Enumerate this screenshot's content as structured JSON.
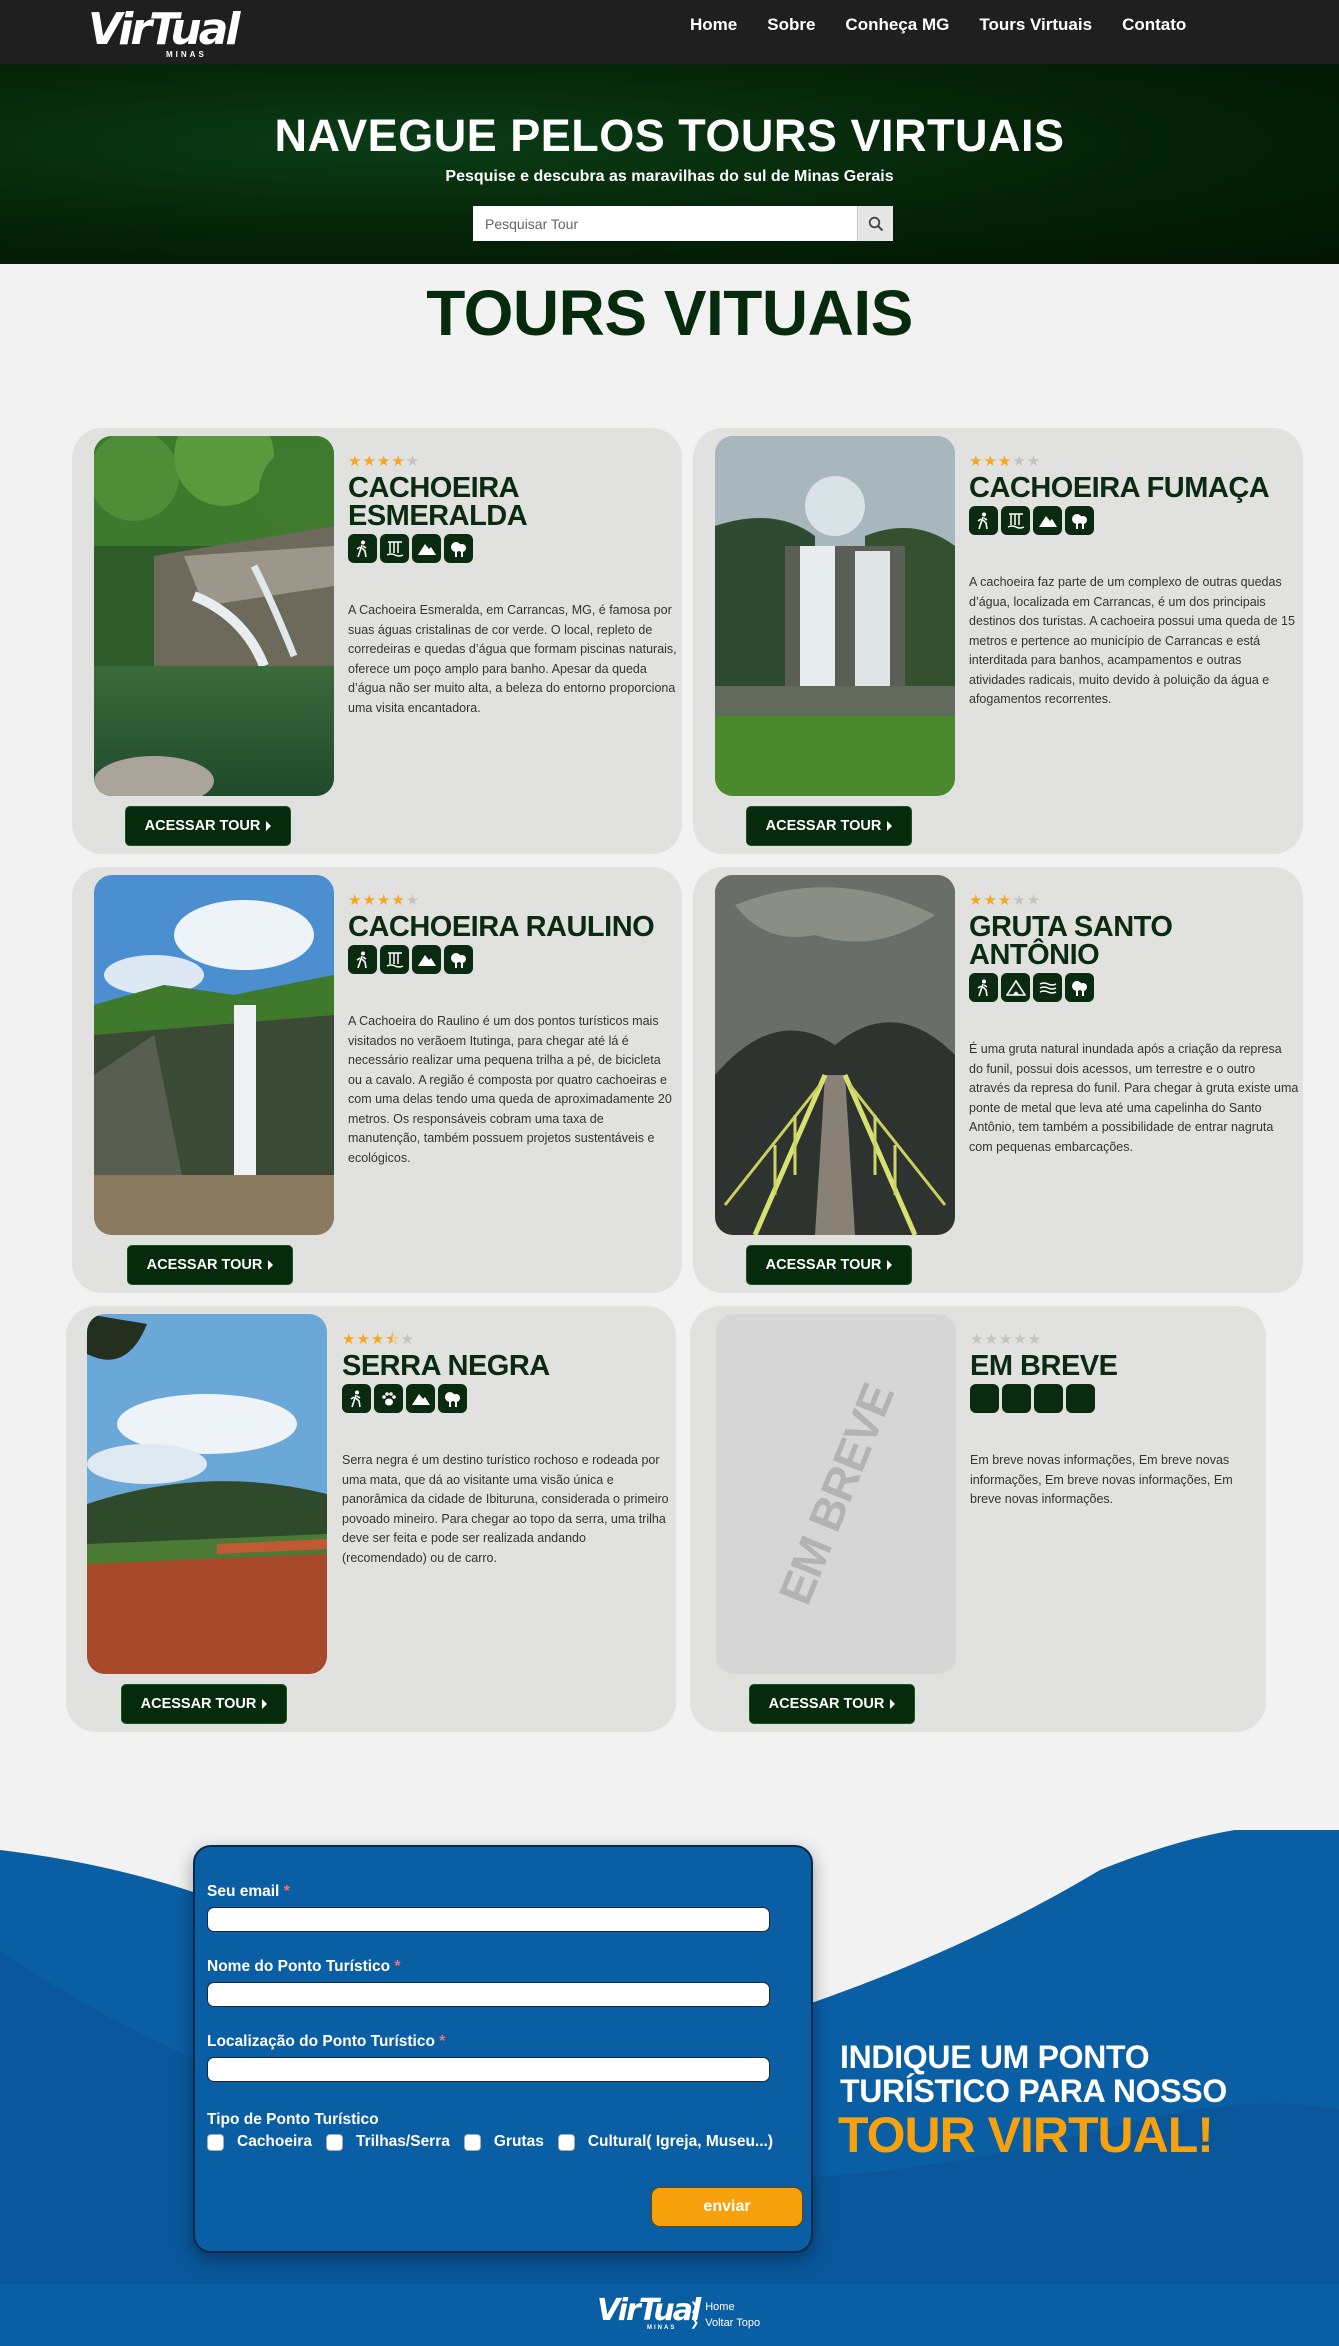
{
  "brand": {
    "logo_text": "VirTual",
    "logo_sub": "MINAS"
  },
  "nav": [
    "Home",
    "Sobre",
    "Conheça MG",
    "Tours Virtuais",
    "Contato"
  ],
  "hero": {
    "title": "NAVEGUE PELOS TOURS VIRTUAIS",
    "subtitle": "Pesquise e descubra as maravilhas do sul de Minas Gerais",
    "search_placeholder": "Pesquisar Tour"
  },
  "section_title": "TOURS VITUAIS",
  "cards": [
    {
      "title": "CACHOEIRA ESMERALDA",
      "rating": 4,
      "icons": [
        "hiker-icon",
        "waterfall-icon",
        "mountain-icon",
        "tree-icon"
      ],
      "description": "A Cachoeira Esmeralda, em Carrancas, MG, é famosa por suas águas cristalinas de cor verde. O local, repleto de corredeiras e quedas d’água que formam piscinas naturais, oferece um poço amplo para banho. Apesar da queda d’água não ser muito alta, a beleza do entorno proporciona uma visita encantadora.",
      "button": "ACESSAR TOUR"
    },
    {
      "title": "CACHOEIRA FUMAÇA",
      "rating": 3,
      "icons": [
        "hiker-icon",
        "waterfall-icon",
        "mountain-icon",
        "tree-icon"
      ],
      "description": "A cachoeira faz parte de um complexo de outras quedas d’água, localizada em Carrancas, é um dos principais destinos dos turistas. A cachoeira possui uma queda de 15 metros e pertence ao município de Carrancas e está interditada para banhos, acampamentos e outras atividades radicais, muito devido à poluição da água e afogamentos recorrentes.",
      "button": "ACESSAR TOUR"
    },
    {
      "title": "CACHOEIRA RAULINO",
      "rating": 4,
      "icons": [
        "hiker-icon",
        "waterfall-icon",
        "mountain-icon",
        "tree-icon"
      ],
      "description": "A Cachoeira do Raulino é um dos pontos turísticos mais visitados no verãoem Itutinga, para chegar até lá é necessário realizar uma pequena trilha a pé, de bicicleta ou a cavalo. A região é composta por quatro cachoeiras e com uma delas tendo uma queda de aproximadamente 20 metros. Os responsáveis cobram uma taxa de manutenção, também possuem projetos sustentáveis e ecológicos.",
      "button": "ACESSAR TOUR"
    },
    {
      "title": "GRUTA SANTO ANTÔNIO",
      "rating": 3,
      "icons": [
        "hiker-icon",
        "cave-icon",
        "water-icon",
        "tree-icon"
      ],
      "description": "É uma gruta natural inundada após a criação da represa do funil, possui dois acessos, um terrestre e o outro através da represa do funil. Para chegar à gruta existe uma ponte de metal que leva até uma capelinha do Santo Antônio, tem também a possibilidade de entrar nagruta com pequenas embarcações.",
      "button": "ACESSAR TOUR"
    },
    {
      "title": "SERRA NEGRA",
      "rating": 3.5,
      "icons": [
        "hiker-icon",
        "paw-icon",
        "mountain-icon",
        "tree-icon"
      ],
      "description": "Serra negra é um destino turístico rochoso e rodeada por uma mata, que dá ao visitante uma visão única e panorâmica da cidade de Ibituruna, considerada o primeiro povoado mineiro. Para chegar ao topo da serra, uma trilha deve ser feita e pode ser realizada andando (recomendado) ou de carro.",
      "button": "ACESSAR TOUR"
    },
    {
      "title": "EM BREVE",
      "rating": 0,
      "icons": [
        "blank-icon",
        "blank-icon",
        "blank-icon",
        "blank-icon"
      ],
      "description": "Em breve novas informações, Em breve novas informações, Em breve novas informações, Em breve novas informações.",
      "placeholder_text": "EM BREVE",
      "button": "ACESSAR TOUR"
    }
  ],
  "form": {
    "email_label": "Seu email",
    "name_label": "Nome do Ponto Turístico",
    "location_label": "Localização do Ponto Turístico",
    "required_mark": "*",
    "type_label": "Tipo de Ponto Turístico",
    "types": [
      "Cachoeira",
      "Trilhas/Serra",
      "Grutas",
      "Cultural( Igreja, Museu...)"
    ],
    "submit": "enviar"
  },
  "cta": {
    "line1": "INDIQUE UM PONTO TURÍSTICO PARA NOSSO",
    "line2": "TOUR VIRTUAL!"
  },
  "footer": {
    "links": [
      "Home",
      "Voltar Topo"
    ]
  },
  "colors": {
    "header_bg": "#1f1f1f",
    "dark_green": "#062a0c",
    "blue": "#0a5ea4",
    "orange": "#f7a10d",
    "star": "#f5a623"
  }
}
